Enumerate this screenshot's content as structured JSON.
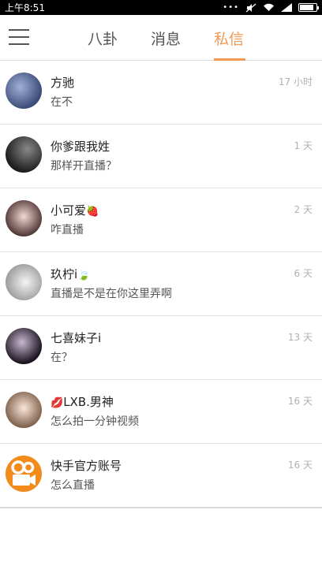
{
  "status": {
    "time": "上午8:51",
    "dots": "•••"
  },
  "tabs": [
    {
      "label": "八卦"
    },
    {
      "label": "消息"
    },
    {
      "label": "私信"
    }
  ],
  "conversations": [
    {
      "name": "方驰",
      "message": "在不",
      "time": "17 小时",
      "avatar_color": "#5a6b8f"
    },
    {
      "name": "你爹跟我姓",
      "message": "那样开直播？",
      "time": "1 天",
      "avatar_color": "#3c3c3c"
    },
    {
      "name": "小可爱",
      "name_emoji": "🍓",
      "message": "咋直播",
      "time": "2 天",
      "avatar_color": "#c9a0a0"
    },
    {
      "name": "玖柠i",
      "name_emoji": "🍃",
      "message": "直播是不是在你这里弄啊",
      "time": "6 天",
      "avatar_color": "#d9d9d9"
    },
    {
      "name": "七喜妹子i",
      "message": "在？",
      "time": "13 天",
      "avatar_color": "#2a2030"
    },
    {
      "name_prefix_emoji": "💋",
      "name": "LXB.男神",
      "message": "怎么拍一分钟视频",
      "time": "16 天",
      "avatar_color": "#d4b39a"
    },
    {
      "name": "快手官方账号",
      "message": "怎么直播",
      "time": "16 天",
      "avatar_color": "#f08c1e"
    }
  ]
}
